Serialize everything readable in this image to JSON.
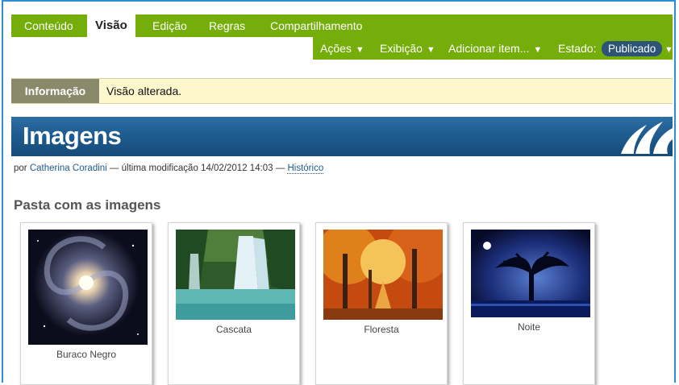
{
  "tabs": [
    {
      "label": "Conteúdo"
    },
    {
      "label": "Visão"
    },
    {
      "label": "Edição"
    },
    {
      "label": "Regras"
    },
    {
      "label": "Compartilhamento"
    }
  ],
  "actions": {
    "acoes": "Ações",
    "exibicao": "Exibição",
    "adicionar": "Adicionar item...",
    "estado_label": "Estado:",
    "estado_value": "Publicado"
  },
  "info": {
    "label": "Informação",
    "message": "Visão alterada."
  },
  "page": {
    "title": "Imagens",
    "byline_prefix": "por",
    "author": "Catherina Coradini",
    "modified": "— última modificação 14/02/2012 14:03 —",
    "history": "Histórico",
    "folder_heading": "Pasta com as imagens"
  },
  "images": [
    {
      "caption": "Buraco Negro"
    },
    {
      "caption": "Cascata"
    },
    {
      "caption": "Floresta"
    },
    {
      "caption": "Noite"
    }
  ],
  "colors": {
    "tab_bar": "#75ad0a",
    "banner": "#1d5a8e",
    "info_bg": "#fdf7ce",
    "state_badge": "#2c5476"
  }
}
